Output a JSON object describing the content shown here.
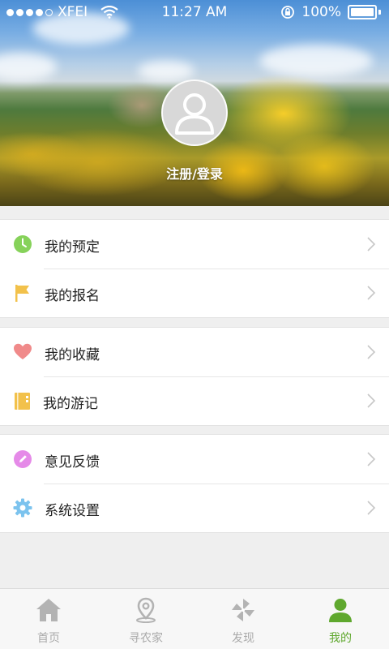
{
  "status_bar": {
    "carrier": "XFEI",
    "time": "11:27 AM",
    "battery": "100%"
  },
  "profile": {
    "login_text": "注册/登录"
  },
  "menu_groups": [
    {
      "items": [
        {
          "label": "我的预定",
          "icon": "clock-icon",
          "color": "#86d25a"
        },
        {
          "label": "我的报名",
          "icon": "flag-icon",
          "color": "#f2c14b"
        }
      ]
    },
    {
      "items": [
        {
          "label": "我的收藏",
          "icon": "heart-icon",
          "color": "#f08a8a"
        },
        {
          "label": "我的游记",
          "icon": "notebook-icon",
          "color": "#f2c14b"
        }
      ]
    },
    {
      "items": [
        {
          "label": "意见反馈",
          "icon": "pencil-icon",
          "color": "#e58ae8"
        },
        {
          "label": "系统设置",
          "icon": "gear-icon",
          "color": "#7cc3ee"
        }
      ]
    }
  ],
  "tabs": [
    {
      "label": "首页",
      "icon": "home-icon",
      "active": false
    },
    {
      "label": "寻农家",
      "icon": "map-pin-icon",
      "active": false
    },
    {
      "label": "发现",
      "icon": "pinwheel-icon",
      "active": false
    },
    {
      "label": "我的",
      "icon": "user-icon",
      "active": true
    }
  ],
  "colors": {
    "active_tab": "#5fa82e",
    "inactive_tab": "#aaaaaa"
  }
}
